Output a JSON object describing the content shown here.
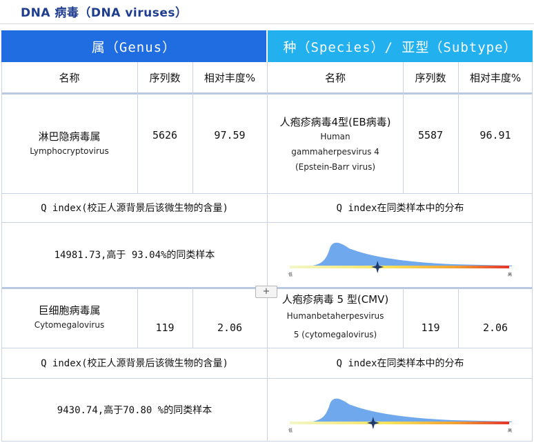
{
  "page_title": "DNA 病毒（DNA viruses）",
  "header": {
    "genus": "属（Genus）",
    "species": "种（Species）/ 亚型（Subtype）"
  },
  "columns": {
    "name": "名称",
    "reads": "序列数",
    "abundance": "相对丰度%"
  },
  "entries": [
    {
      "genus_cn": "淋巴隐病毒属",
      "genus_en": "Lymphocryptovirus",
      "genus_reads": "5626",
      "genus_abundance": "97.59",
      "species_cn": "人疱疹病毒4型(EB病毒)",
      "species_en_1": "Human",
      "species_en_2": "gammaherpesvirus 4",
      "species_en_3": "(Epstein-Barr virus)",
      "species_reads": "5587",
      "species_abundance": "96.91",
      "q_label": "Q index(校正人源背景后该微生物的含量)",
      "q_value": "14981.73,高于 93.04%的同类样本",
      "dist_label": "Q index在同类样本中的分布",
      "dist_marker_fraction": 0.4,
      "dist_low": "低",
      "dist_high": "高"
    },
    {
      "genus_cn": "巨细胞病毒属",
      "genus_en": "Cytomegalovirus",
      "genus_reads": "119",
      "genus_abundance": "2.06",
      "species_cn": "人疱疹病毒 5 型(CMV)",
      "species_en_1": "Humanbetaherpesvirus",
      "species_en_2": "5 (cytomegalovirus)",
      "species_reads": "119",
      "species_abundance": "2.06",
      "q_label": "Q index(校正人源背景后该微生物的含量)",
      "q_value": "9430.74,高于70.80 %的同类样本",
      "dist_label": "Q index在同类样本中的分布",
      "dist_marker_fraction": 0.38,
      "dist_low": "低",
      "dist_high": "高"
    }
  ],
  "colors": {
    "title": "#1f3d8f",
    "header_genus": "#1f6de0",
    "header_species": "#22b0ef",
    "distribution_fill": "#6fa8ec",
    "marker": "#1e3a6e"
  },
  "icons": {
    "marker": "star-marker-icon",
    "expand": "plus-icon"
  },
  "expand_button": "+"
}
